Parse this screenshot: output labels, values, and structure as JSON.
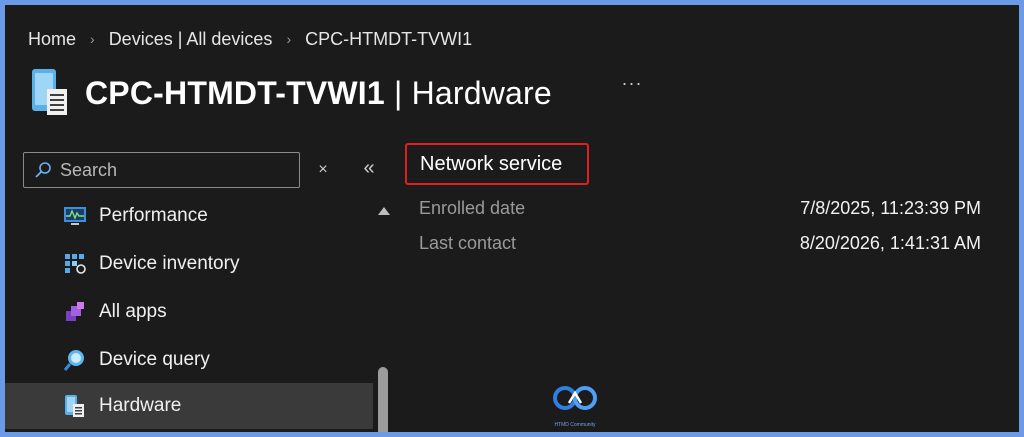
{
  "breadcrumb": {
    "items": [
      "Home",
      "Devices | All devices",
      "CPC-HTMDT-TVWI1"
    ],
    "separator": "›"
  },
  "title": {
    "device": "CPC-HTMDT-TVWI1",
    "separator": "|",
    "section": "Hardware",
    "icon": "device-hardware-icon"
  },
  "more": "···",
  "search": {
    "placeholder": "Search",
    "value": ""
  },
  "controls": {
    "clear": "×",
    "collapse": "«"
  },
  "sidebar": {
    "items": [
      {
        "label": "Performance",
        "icon": "performance-icon",
        "selected": false
      },
      {
        "label": "Device inventory",
        "icon": "device-inventory-icon",
        "selected": false
      },
      {
        "label": "All apps",
        "icon": "all-apps-icon",
        "selected": false
      },
      {
        "label": "Device query",
        "icon": "device-query-icon",
        "selected": false
      },
      {
        "label": "Hardware",
        "icon": "hardware-icon",
        "selected": true
      }
    ]
  },
  "content": {
    "section_title": "Network service",
    "properties": [
      {
        "label": "Enrolled date",
        "value": "7/8/2025, 11:23:39 PM"
      },
      {
        "label": "Last contact",
        "value": "8/20/2026, 1:41:31 AM"
      }
    ]
  },
  "watermark": {
    "text": "HTMD Community"
  },
  "colors": {
    "background": "#1b1b1b",
    "outer_border": "#6b9ae6",
    "highlight_box": "#e02020",
    "selected_item": "#3a3a3a",
    "muted_text": "#9a9a9a"
  }
}
